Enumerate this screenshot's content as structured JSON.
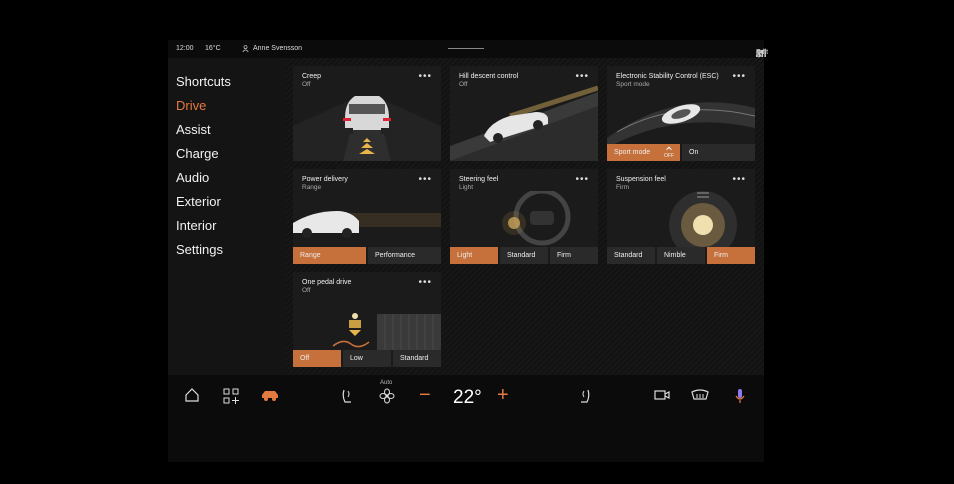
{
  "status": {
    "time": "12:00",
    "temp": "16°C",
    "user": "Anne Svensson",
    "edit": "Edit",
    "icons": [
      "edit-icon",
      "bluetooth-icon",
      "signal-icon"
    ]
  },
  "sidebar": {
    "items": [
      {
        "label": "Shortcuts",
        "active": false
      },
      {
        "label": "Drive",
        "active": true
      },
      {
        "label": "Assist",
        "active": false
      },
      {
        "label": "Charge",
        "active": false
      },
      {
        "label": "Audio",
        "active": false
      },
      {
        "label": "Exterior",
        "active": false
      },
      {
        "label": "Interior",
        "active": false
      },
      {
        "label": "Settings",
        "active": false
      }
    ]
  },
  "cards": {
    "creep": {
      "title": "Creep",
      "value": "Off"
    },
    "hill": {
      "title": "Hill descent control",
      "value": "Off"
    },
    "esc": {
      "title": "Electronic Stability Control (ESC)",
      "value": "Sport mode",
      "options": [
        "Sport mode",
        "On"
      ],
      "selected": 0,
      "badge": "OFF"
    },
    "power": {
      "title": "Power delivery",
      "value": "Range",
      "options": [
        "Range",
        "Performance"
      ],
      "selected": 0
    },
    "steering": {
      "title": "Steering feel",
      "value": "Light",
      "options": [
        "Light",
        "Standard",
        "Firm"
      ],
      "selected": 0
    },
    "suspension": {
      "title": "Suspension feel",
      "value": "Firm",
      "options": [
        "Standard",
        "Nimble",
        "Firm"
      ],
      "selected": 2
    },
    "onepedal": {
      "title": "One pedal drive",
      "value": "Off",
      "options": [
        "Off",
        "Low",
        "Standard"
      ],
      "selected": 0
    },
    "more_label": "•••"
  },
  "climate": {
    "fan_mode": "Auto",
    "temperature": "22°",
    "minus": "−",
    "plus": "+"
  },
  "colors": {
    "accent": "#e47a3f",
    "selected_option": "#c6703b",
    "card_bg": "#1b1b1b"
  }
}
